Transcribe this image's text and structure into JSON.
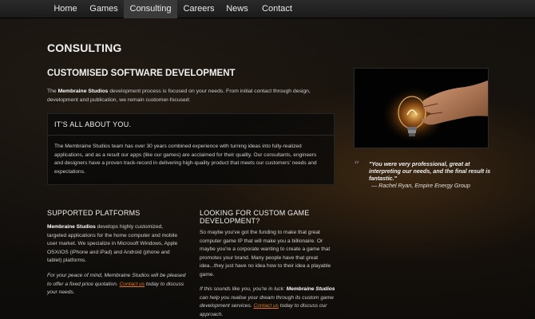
{
  "nav": {
    "items": [
      {
        "label": "Home"
      },
      {
        "label": "Games"
      },
      {
        "label": "Consulting"
      },
      {
        "label": "Careers"
      },
      {
        "label": "News"
      },
      {
        "label": "Contact"
      }
    ],
    "active": "Consulting"
  },
  "page": {
    "title": "CONSULTING",
    "section_title": "CUSTOMISED SOFTWARE DEVELOPMENT",
    "intro_pre": "The ",
    "intro_brand": "Membraine Studios",
    "intro_post": " development process is focused on your needs. From initial contact through design, development and publication, we remain customer-focused:"
  },
  "panel": {
    "title": "IT'S ALL ABOUT YOU.",
    "body": "The Membraine Studios team has over 30 years combined experience with turning ideas into fully-realized applications, and as a result our apps (like our games) are acclaimed for their quality. Our consultants, engineers and designers have a proven track-record in delivering high-quality product that meets our customers' needs and expectations."
  },
  "testimonial": {
    "quote_mark": "“",
    "quote": "\"You were very professional, great at interpreting our needs, and the final result is fantastic.\"",
    "author": "— Rachel Ryan, Empire Energy Group"
  },
  "platforms": {
    "title": "SUPPORTED PLATFORMS",
    "brand": "Membraine Studios",
    "body": " develops highly customized, targeted applications for the home computer and mobile user market. We specialize in Microsoft Windows, Apple OSX/iOS (iPhone and iPad) and Android (phone and tablet) platforms.",
    "note_pre": "For your peace of mind, Membraine Studios will be pleased to offer a fixed price quotation. ",
    "note_link": "Contact us",
    "note_post": " today to discuss your needs."
  },
  "custom_games": {
    "title": "LOOKING FOR CUSTOM GAME DEVELOPMENT?",
    "body": "So maybe you've got the funding to make that great computer game IP that will make you a billionaire. Or maybe you're a corporate wanting to create a game that promotes your brand. Many people have that great idea...they just have no idea how to their idea a playable game.",
    "note_pre": "If this sounds like you, you're in luck: ",
    "note_brand": "Membraine Studios",
    "note_mid": " can help you realise your dream through its custom game development services. ",
    "note_link": "Contact us",
    "note_post": " today to discuss our approach."
  },
  "colors": {
    "accent_link": "#e07a1e",
    "background": "#15120f",
    "nav_background": "#222222"
  }
}
